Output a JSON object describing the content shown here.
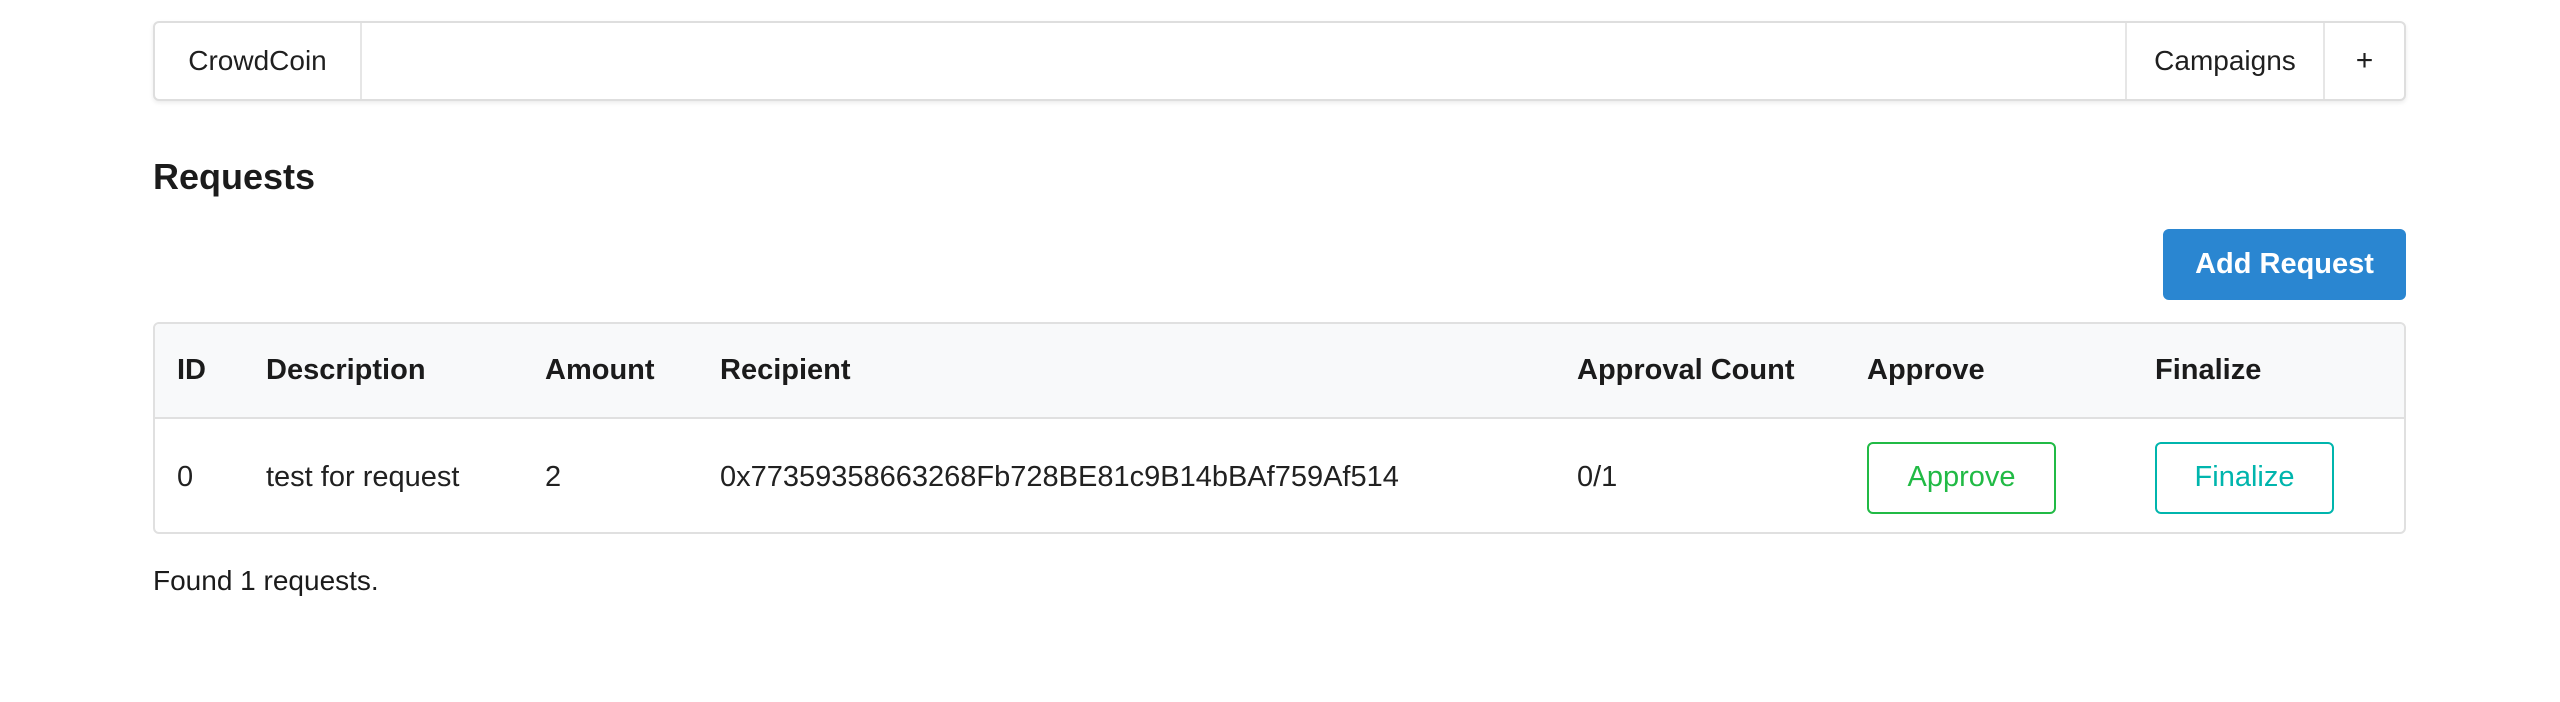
{
  "menu": {
    "brand": "CrowdCoin",
    "campaigns": "Campaigns",
    "add": "+"
  },
  "page": {
    "title": "Requests",
    "add_request_label": "Add Request",
    "found_text": "Found 1 requests."
  },
  "table": {
    "headers": [
      "ID",
      "Description",
      "Amount",
      "Recipient",
      "Approval Count",
      "Approve",
      "Finalize"
    ],
    "rows": [
      {
        "id": "0",
        "description": "test for request",
        "amount": "2",
        "recipient": "0x77359358663268Fb728BE81c9B14bBAf759Af514",
        "approval_count": "0/1",
        "approve_label": "Approve",
        "finalize_label": "Finalize"
      }
    ]
  },
  "colors": {
    "primary": "#2a86d1",
    "approve": "#21ba45",
    "finalize": "#00b5ad"
  }
}
